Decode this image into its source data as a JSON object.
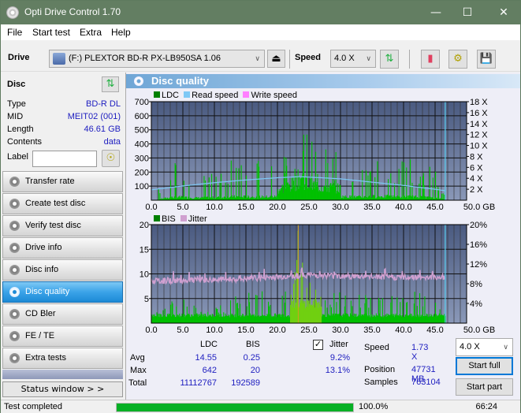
{
  "window": {
    "title": "Opti Drive Control 1.70",
    "minimize": "—",
    "maximize": "☐",
    "close": "✕"
  },
  "menu": [
    "File",
    "Start test",
    "Extra",
    "Help"
  ],
  "toolbar": {
    "drive_label": "Drive",
    "drive_value": "(F:)  PLEXTOR BD-R  PX-LB950SA 1.06",
    "speed_label": "Speed",
    "speed_value": "4.0 X"
  },
  "disc": {
    "header": "Disc",
    "rows": [
      {
        "key": "Type",
        "value": "BD-R DL"
      },
      {
        "key": "MID",
        "value": "MEIT02 (001)"
      },
      {
        "key": "Length",
        "value": "46.61 GB"
      },
      {
        "key": "Contents",
        "value": "data"
      }
    ],
    "label_key": "Label",
    "label_value": ""
  },
  "nav": [
    {
      "label": "Transfer rate",
      "active": false
    },
    {
      "label": "Create test disc",
      "active": false
    },
    {
      "label": "Verify test disc",
      "active": false
    },
    {
      "label": "Drive info",
      "active": false
    },
    {
      "label": "Disc info",
      "active": false
    },
    {
      "label": "Disc quality",
      "active": true
    },
    {
      "label": "CD Bler",
      "active": false
    },
    {
      "label": "FE / TE",
      "active": false
    },
    {
      "label": "Extra tests",
      "active": false
    }
  ],
  "status_window_button": "Status window > >",
  "panel_title": "Disc quality",
  "colors": {
    "ldc": "#00c000",
    "read_speed": "#7ec8f5",
    "write_speed": "#ff80ff",
    "bis": "#00c000",
    "jitter": "#d0a0d0",
    "plot_bg_top": "#4a5a80",
    "plot_bg_bottom": "#8a98b8",
    "progress": "#06b025",
    "accent": "#2020c0"
  },
  "chart_data": [
    {
      "type": "bar",
      "title": "LDC / Read speed",
      "legend": [
        "LDC",
        "Read speed",
        "Write speed"
      ],
      "legend_placement": "top-left",
      "xlabel": "GB",
      "x_ticks": [
        "0.0",
        "5.0",
        "10.0",
        "15.0",
        "20.0",
        "25.0",
        "30.0",
        "35.0",
        "40.0",
        "45.0",
        "50.0 GB"
      ],
      "xlim": [
        0,
        50
      ],
      "y_ticks": [
        "100",
        "200",
        "300",
        "400",
        "500",
        "600",
        "700"
      ],
      "ylim": [
        0,
        700
      ],
      "y2_ticks": [
        "2 X",
        "4 X",
        "6 X",
        "8 X",
        "10 X",
        "12 X",
        "14 X",
        "16 X",
        "18 X"
      ],
      "y2lim": [
        0,
        18
      ],
      "grid": true,
      "end_marker_gb": 46.61,
      "series": [
        {
          "name": "LDC (approx envelope peaks)",
          "x": [
            0.5,
            3,
            4,
            5,
            7,
            10,
            13,
            15,
            17,
            19,
            21,
            22.5,
            23.5,
            24,
            25,
            27,
            29,
            31,
            33,
            35,
            37,
            39,
            41,
            43,
            45,
            46.6
          ],
          "values": [
            30,
            240,
            280,
            250,
            200,
            230,
            300,
            290,
            280,
            300,
            350,
            450,
            642,
            600,
            430,
            380,
            350,
            300,
            280,
            320,
            330,
            290,
            310,
            260,
            230,
            20
          ]
        },
        {
          "name": "Read speed (X)",
          "x": [
            0,
            5,
            10,
            15,
            20,
            23.5,
            27,
            30,
            35,
            40,
            45,
            46.6
          ],
          "values": [
            1.9,
            2.6,
            3.2,
            3.7,
            4.1,
            4.3,
            4.1,
            3.9,
            3.3,
            2.7,
            2.0,
            1.73
          ]
        }
      ]
    },
    {
      "type": "bar",
      "title": "BIS / Jitter",
      "legend": [
        "BIS",
        "Jitter"
      ],
      "legend_placement": "top-left",
      "xlabel": "GB",
      "x_ticks": [
        "0.0",
        "5.0",
        "10.0",
        "15.0",
        "20.0",
        "25.0",
        "30.0",
        "35.0",
        "40.0",
        "45.0",
        "50.0 GB"
      ],
      "xlim": [
        0,
        50
      ],
      "y_ticks": [
        "5",
        "10",
        "15",
        "20"
      ],
      "ylim": [
        0,
        20
      ],
      "y2_ticks": [
        "4%",
        "8%",
        "12%",
        "16%",
        "20%"
      ],
      "y2lim": [
        0,
        20
      ],
      "grid": true,
      "end_marker_gb": 46.61,
      "series": [
        {
          "name": "BIS (approx envelope peaks)",
          "x": [
            0.5,
            3,
            5,
            8,
            10,
            13,
            15,
            17,
            20,
            22.5,
            23.3,
            24,
            26,
            28,
            30,
            33,
            36,
            39,
            42,
            44,
            46.6
          ],
          "values": [
            2,
            6,
            6,
            3,
            3,
            6,
            6,
            7,
            5,
            12,
            20,
            12,
            7,
            6,
            7,
            6,
            6,
            6,
            7,
            6,
            2
          ]
        },
        {
          "name": "Jitter (%)",
          "x": [
            0,
            5,
            10,
            15,
            20,
            23,
            25,
            30,
            35,
            40,
            45,
            46.6
          ],
          "values": [
            8.5,
            8.7,
            8.8,
            9.0,
            9.4,
            9.6,
            9.8,
            9.6,
            9.4,
            9.3,
            9.4,
            9.2
          ]
        }
      ]
    }
  ],
  "stats": {
    "col_ldc": "LDC",
    "col_bis": "BIS",
    "jitter_label": "Jitter",
    "jitter_checked": true,
    "rows": [
      {
        "label": "Avg",
        "ldc": "14.55",
        "bis": "0.25",
        "jitter": "9.2%"
      },
      {
        "label": "Max",
        "ldc": "642",
        "bis": "20",
        "jitter": "13.1%"
      },
      {
        "label": "Total",
        "ldc": "11112767",
        "bis": "192589",
        "jitter": ""
      }
    ],
    "speed_label": "Speed",
    "speed_value": "1.73 X",
    "position_label": "Position",
    "position_value": "47731 MB",
    "samples_label": "Samples",
    "samples_value": "763104",
    "speed_select": "4.0 X",
    "start_full": "Start full",
    "start_part": "Start part"
  },
  "statusbar": {
    "text": "Test completed",
    "progress_percent": 100,
    "progress_label": "100.0%",
    "elapsed": "66:24"
  }
}
